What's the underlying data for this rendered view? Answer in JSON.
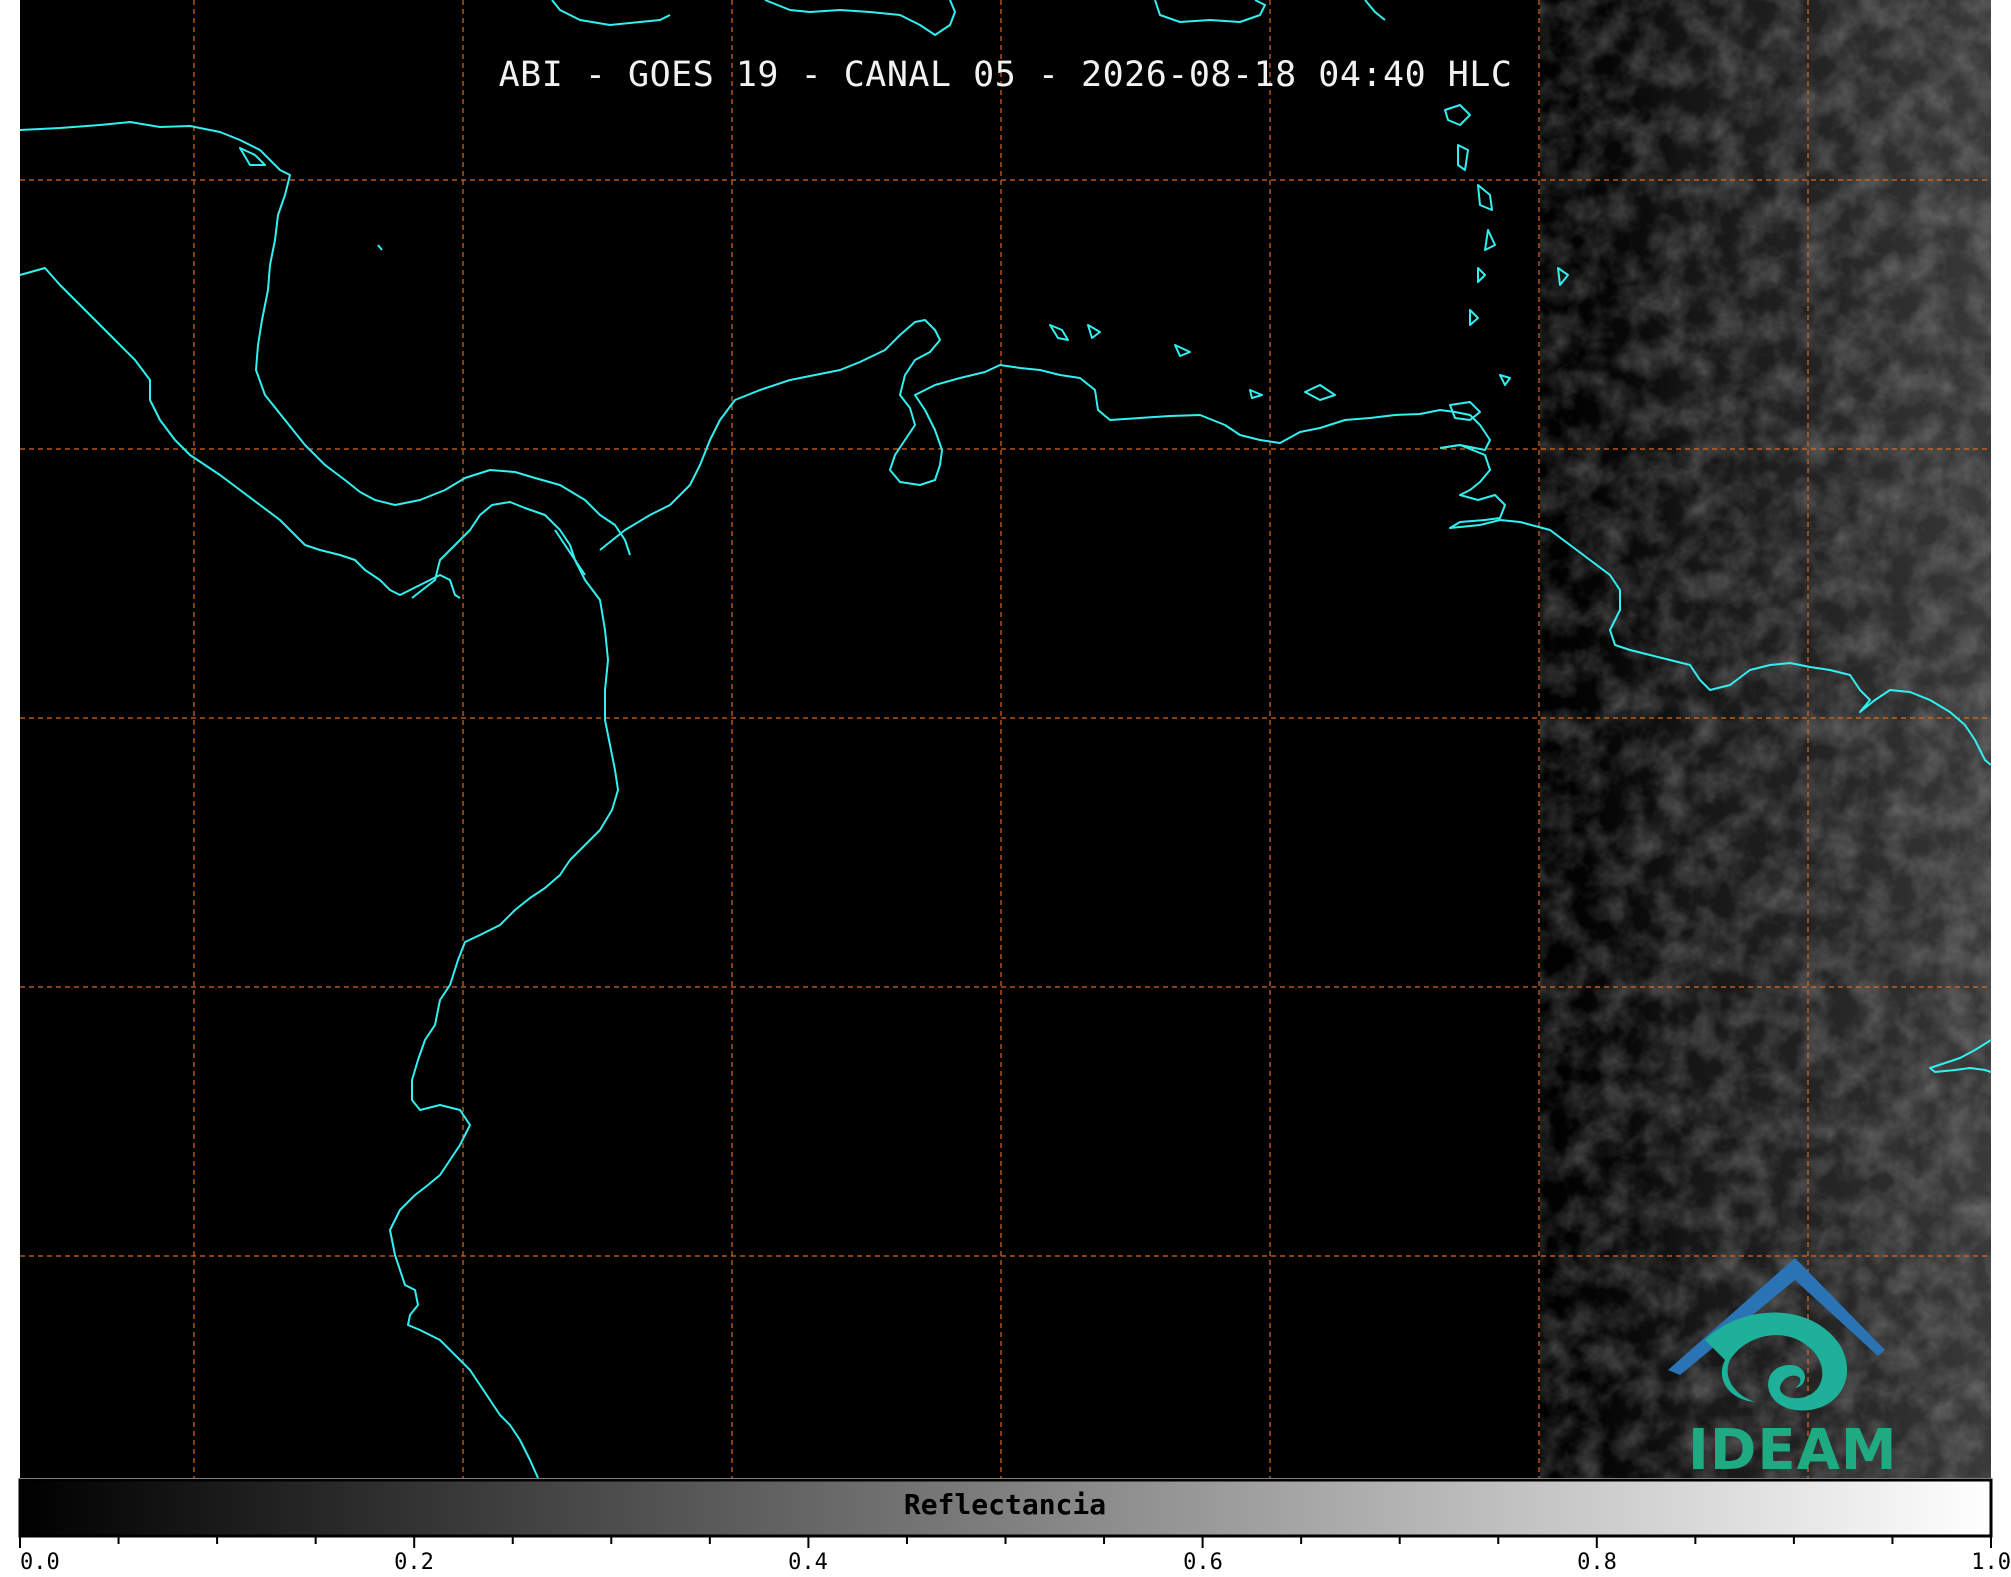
{
  "title": "ABI - GOES 19 - CANAL 05 - 2026-08-18 04:40 HLC",
  "colorbar": {
    "label": "Reflectancia",
    "ticks": [
      "0.0",
      "0.2",
      "0.4",
      "0.6",
      "0.8",
      "1.0"
    ],
    "range": [
      0.0,
      1.0
    ],
    "cmap": "gray"
  },
  "logo": {
    "text": "IDEAM",
    "color_text": "#1faa82",
    "color_roof": "#2a74b5",
    "color_spiral": "#1fb09a"
  },
  "colors": {
    "coastline": "#33f0f0",
    "grid": "#d96a1e",
    "background": "#000000"
  }
}
